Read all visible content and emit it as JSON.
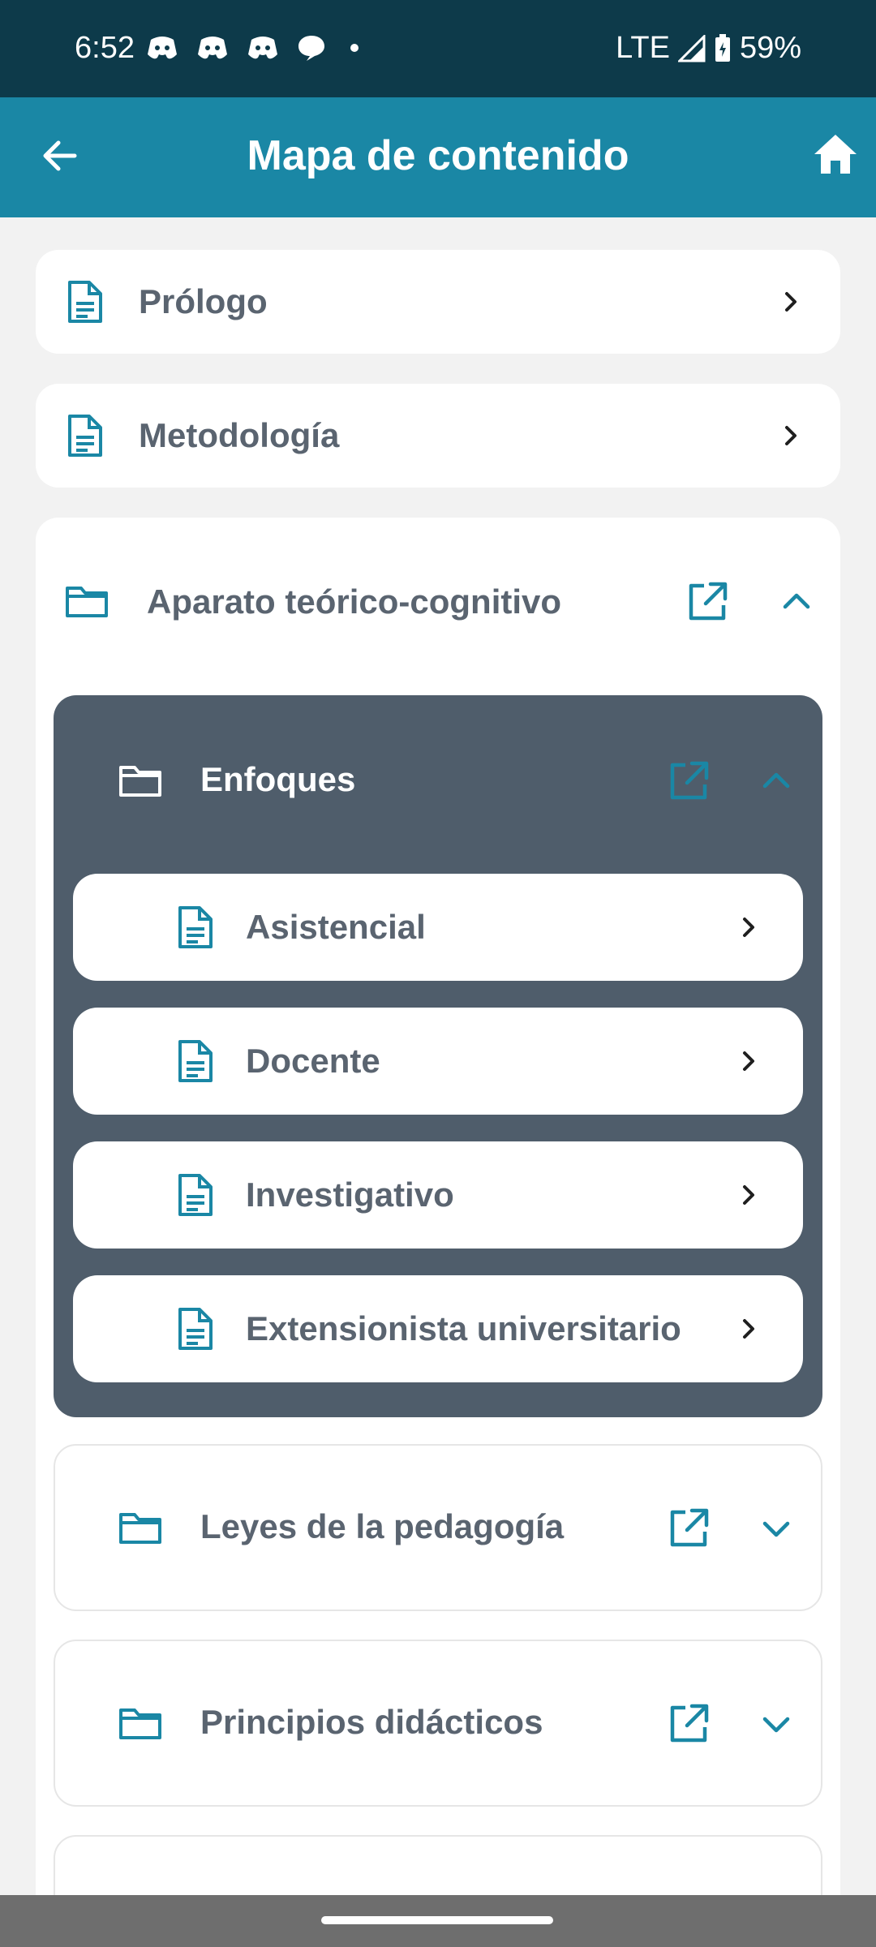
{
  "status_bar": {
    "time": "6:52",
    "network": "LTE",
    "battery": "59%"
  },
  "app_bar": {
    "title": "Mapa de contenido"
  },
  "items": {
    "prologo": "Prólogo",
    "metodologia": "Metodología",
    "aparato": "Aparato teórico-cognitivo",
    "enfoques": "Enfoques",
    "asistencial": "Asistencial",
    "docente": "Docente",
    "investigativo": "Investigativo",
    "extensionista": "Extensionista universitario",
    "leyes": "Leyes de la pedagogía",
    "principios": "Principios didácticos"
  },
  "colors": {
    "accent": "#1a87a5",
    "status_bar": "#0d3a4a",
    "dark_group": "#4f5d6b",
    "text": "#5a6470"
  }
}
